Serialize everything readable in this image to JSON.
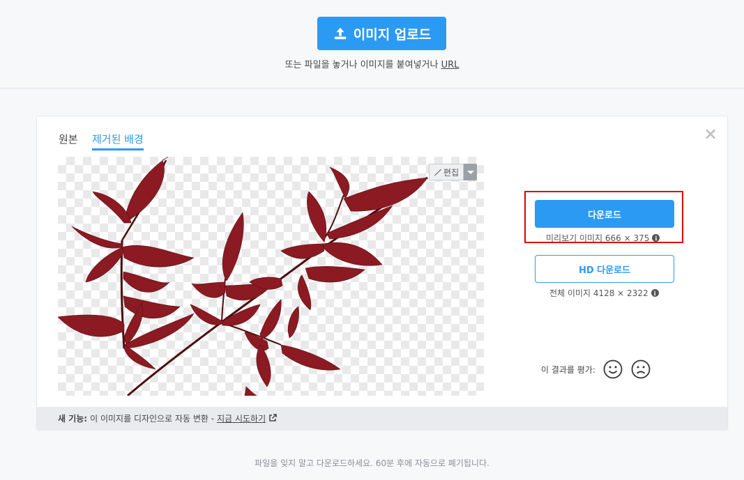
{
  "upload": {
    "button_label": "이미지 업로드",
    "hint_text": "또는 파일을 놓거나 이미지를 붙여넣거나",
    "hint_link": "URL"
  },
  "card": {
    "tabs": [
      {
        "label": "원본",
        "active": false
      },
      {
        "label": "제거된 배경",
        "active": true
      }
    ],
    "close_symbol": "×",
    "edit_label": "편집",
    "download": {
      "label": "다운로드",
      "preview_info": "미리보기 이미지 666 × 375",
      "hd_label": "HD 다운로드",
      "full_info": "전체 이미지 4128 × 2322"
    },
    "rate_label": "이 결과를 평가:",
    "footer": {
      "prefix": "새 기능:",
      "text": "이 이미지를 디자인으로 자동 변환 -",
      "link": "지금 시도하기"
    }
  },
  "bottom_note": "파일을 잊지 말고 다운로드하세요. 60분 후에 자동으로 폐기됩니다.",
  "colors": {
    "accent": "#2b9af3",
    "highlight_border": "#e00000",
    "leaf": "#8b1a22"
  }
}
